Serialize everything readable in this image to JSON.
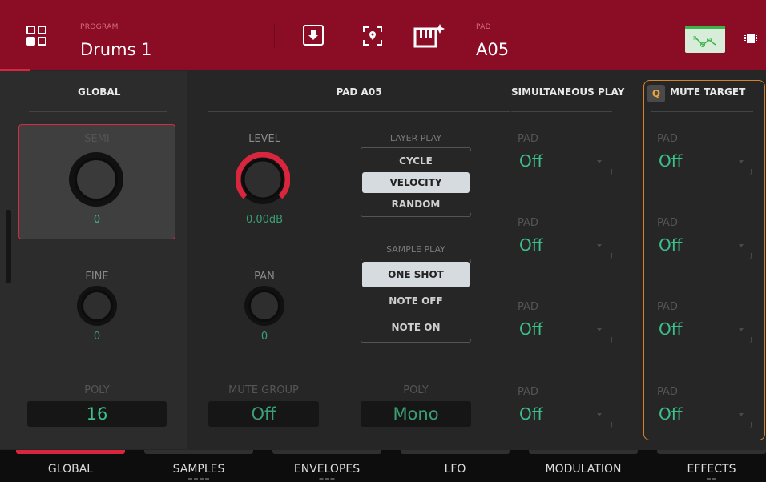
{
  "header": {
    "program_label": "PROGRAM",
    "program_name": "Drums 1",
    "pad_label": "PAD",
    "pad_name": "A05",
    "icons": [
      "browse-menu-icon",
      "save-icon",
      "locate-icon",
      "keyboard-edit-icon",
      "grid-view-icon",
      "chip-icon"
    ],
    "accent_color": "#8a0c25"
  },
  "global": {
    "title": "GLOBAL",
    "semi_label": "SEMI",
    "semi_value": "0",
    "fine_label": "FINE",
    "fine_value": "0",
    "poly_label": "POLY",
    "poly_value": "16"
  },
  "pad": {
    "title": "PAD A05",
    "level_label": "LEVEL",
    "level_value": "0.00dB",
    "pan_label": "PAN",
    "pan_value": "0",
    "mute_group_label": "MUTE GROUP",
    "mute_group_value": "Off",
    "layer_play_label": "LAYER PLAY",
    "layer_play_options": [
      "CYCLE",
      "VELOCITY",
      "RANDOM"
    ],
    "layer_play_selected": "VELOCITY",
    "sample_play_label": "SAMPLE PLAY",
    "sample_play_options": [
      "ONE SHOT",
      "NOTE OFF",
      "NOTE ON"
    ],
    "sample_play_selected": "ONE SHOT",
    "poly_label": "POLY",
    "poly_value": "Mono"
  },
  "simultaneous_play": {
    "title": "SIMULTANEOUS PLAY",
    "pads": [
      {
        "label": "PAD",
        "value": "Off"
      },
      {
        "label": "PAD",
        "value": "Off"
      },
      {
        "label": "PAD",
        "value": "Off"
      },
      {
        "label": "PAD",
        "value": "Off"
      }
    ]
  },
  "mute_target": {
    "badge": "Q",
    "title": "MUTE TARGET",
    "pads": [
      {
        "label": "PAD",
        "value": "Off"
      },
      {
        "label": "PAD",
        "value": "Off"
      },
      {
        "label": "PAD",
        "value": "Off"
      },
      {
        "label": "PAD",
        "value": "Off"
      }
    ]
  },
  "tabs": [
    {
      "label": "GLOBAL",
      "active": true
    },
    {
      "label": "SAMPLES",
      "active": false
    },
    {
      "label": "ENVELOPES",
      "active": false
    },
    {
      "label": "LFO",
      "active": false
    },
    {
      "label": "MODULATION",
      "active": false
    },
    {
      "label": "EFFECTS",
      "active": false
    }
  ],
  "colors": {
    "value_green": "#3cc08a",
    "selection_red": "#d7263d",
    "mute_outline": "#d4822d"
  }
}
